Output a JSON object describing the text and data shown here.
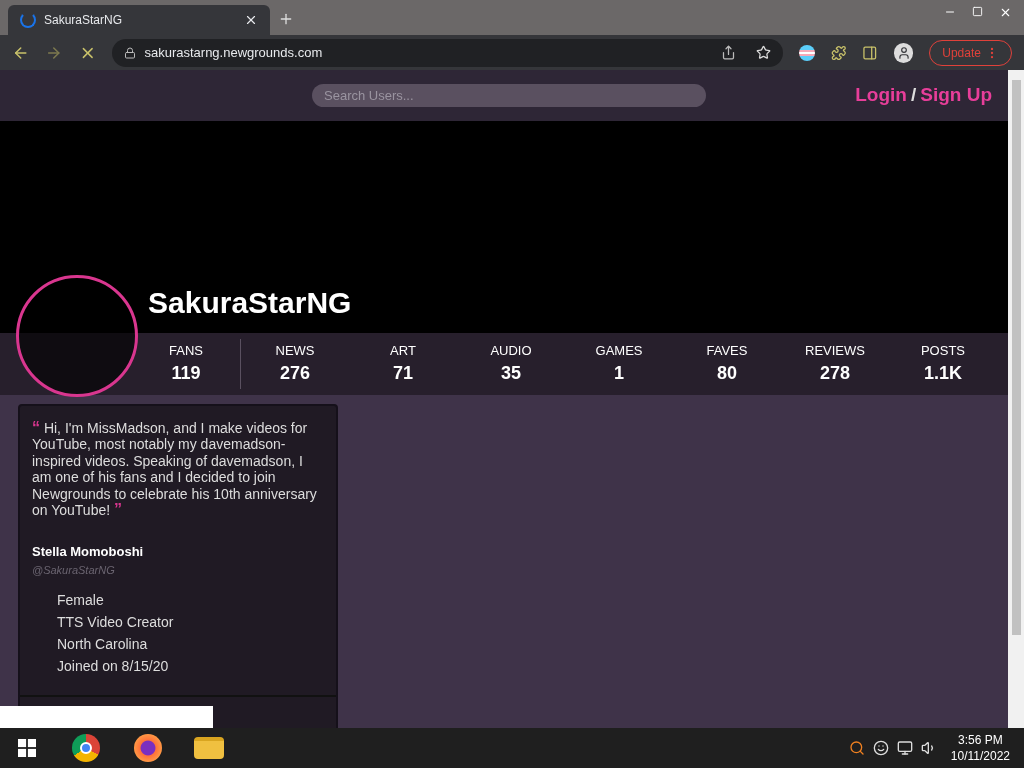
{
  "browser": {
    "tab": {
      "title": "SakuraStarNG",
      "loading": true
    },
    "url": "sakurastarng.newgrounds.com",
    "update_button": "Update"
  },
  "header": {
    "search": {
      "placeholder": "Search Users..."
    },
    "login": "Login",
    "separator": "/",
    "signup": "Sign Up"
  },
  "profile": {
    "username": "SakuraStarNG"
  },
  "stats": [
    {
      "label": "FANS",
      "value": "119"
    },
    {
      "label": "NEWS",
      "value": "276"
    },
    {
      "label": "ART",
      "value": "71"
    },
    {
      "label": "AUDIO",
      "value": "35"
    },
    {
      "label": "GAMES",
      "value": "1"
    },
    {
      "label": "FAVES",
      "value": "80"
    },
    {
      "label": "REVIEWS",
      "value": "278"
    },
    {
      "label": "POSTS",
      "value": "1.1K"
    }
  ],
  "bio": {
    "open_quote": "“",
    "text": "Hi, I'm MissMadson, and I make videos for YouTube, most notably my davemadson-inspired videos. Speaking of davemadson, I am one of his fans and I decided to join Newgrounds to celebrate his 10th anniversary on YouTube!",
    "close_quote": "”",
    "name": "Stella Momoboshi",
    "handle": "@SakuraStarNG",
    "details": [
      "Female",
      "TTS Video Creator",
      "North Carolina",
      "Joined on 8/15/20"
    ]
  },
  "taskbar": {
    "time": "3:56 PM",
    "date": "10/11/2022"
  }
}
